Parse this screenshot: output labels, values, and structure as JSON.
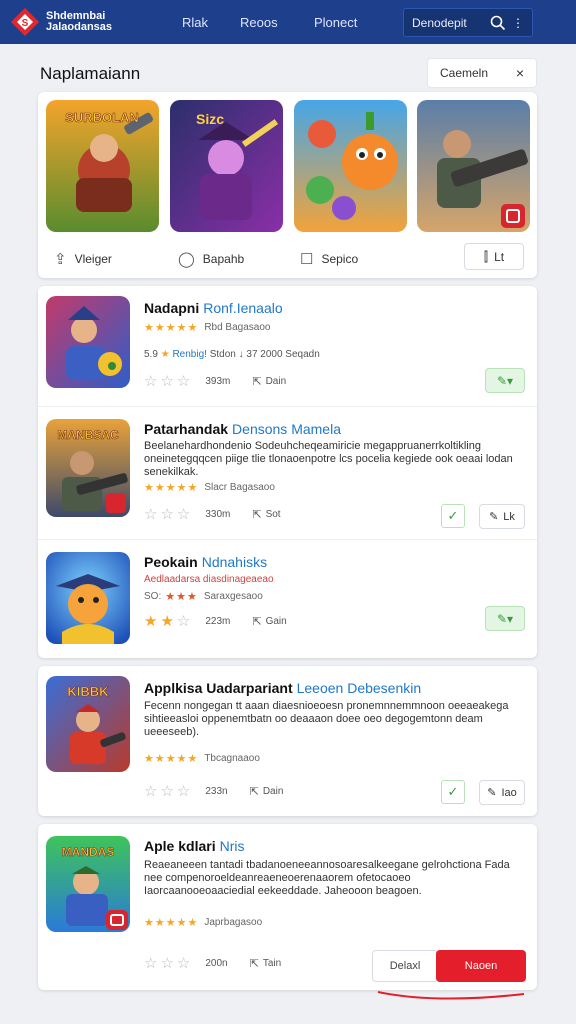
{
  "topbar": {
    "logo_line1": "Shdemnbai",
    "logo_line2": "Jalaodansas",
    "nav": [
      "Rlak",
      "Reoos",
      "Plonect"
    ],
    "search_label": "Denodepit",
    "search_icon": "search-icon",
    "more_icon": "more-dots-icon",
    "bg_color": "#1e3f8c"
  },
  "hero": {
    "title": "Naplamaiann",
    "chip_label": "Caemeln",
    "close_glyph": "×",
    "actions": [
      {
        "label": "Vleiger",
        "icon": "share-icon"
      },
      {
        "label": "Bapahb",
        "icon": "bubble-icon"
      },
      {
        "label": "Sepico",
        "icon": "square-icon"
      }
    ],
    "button_label": "Lt",
    "thumb_labels": [
      "SURBOLAN",
      "Sizc",
      "",
      ""
    ]
  },
  "list": [
    {
      "title": "Nadapni",
      "subtitle": "Ronf.Ienaalo",
      "icon_label": "",
      "rating_text": "Rbd Bagasaoo",
      "meta_prefix": "5.9",
      "meta_highlight": "Renbig!",
      "meta_rest": "Stdon ↓ 37 2000 Seqadn",
      "size": "393m",
      "action_label": "Dain",
      "button": "green"
    },
    {
      "title": "Patarhandak",
      "subtitle": "Densons Mamela",
      "icon_label": "MANBSAC",
      "description": "Beelanehardhondenio Sodeuhcheqeamiricie megappruanerrkoltikling oneinetegqqcen piige tlie tlonaoenpotre lcs pocelia kegiede ook oeaai lodan senekilkak.",
      "rating_text": "Slacr Bagasaoo",
      "size": "330m",
      "action_label": "Sot",
      "button_label": "Lk"
    },
    {
      "title": "Peokain",
      "subtitle": "Ndnahisks",
      "icon_label": "",
      "line2": "Aedlaadarsa diasdinageaeao",
      "rating_text": "Saraxgesaoo",
      "meta_prefix": "SO:",
      "size": "223m",
      "action_label": "Gain",
      "button": "green"
    },
    {
      "title": "Applkisa Uadarpariant",
      "subtitle": "Leeoen Debesenkin",
      "icon_label": "KIBBK",
      "description": "Fecenn nongegan tt aaan diaesnioeoesn pronemnnemmnoon oeeaeakega sihtieeasloi oppenemtbatn oo deaaaon doee oeo degogemtonn deam ueeeseeb).",
      "rating_text": "Tbcagnaaoo",
      "size": "233n",
      "action_label": "Dain",
      "button_label": "Iao"
    },
    {
      "title": "Aple kdlari",
      "subtitle": "Nris",
      "icon_label": "MANDAS",
      "description": "Reaeaneeen tantadi tbadanoeneeannosoaresalkeegane gelrohctiona Fada nee compenoroeldeanreaeneoerenaaorem ofetocaoeo Iaorcaanooeoaaciedial eekeeddade. Jaheooon beagoen.",
      "rating_text": "Japrbagasoo",
      "size": "200n",
      "action_label": "Tain"
    }
  ],
  "footer": {
    "default_label": "Delaxl",
    "primary_label": "Naoen",
    "primary_color": "#e41e2b"
  }
}
